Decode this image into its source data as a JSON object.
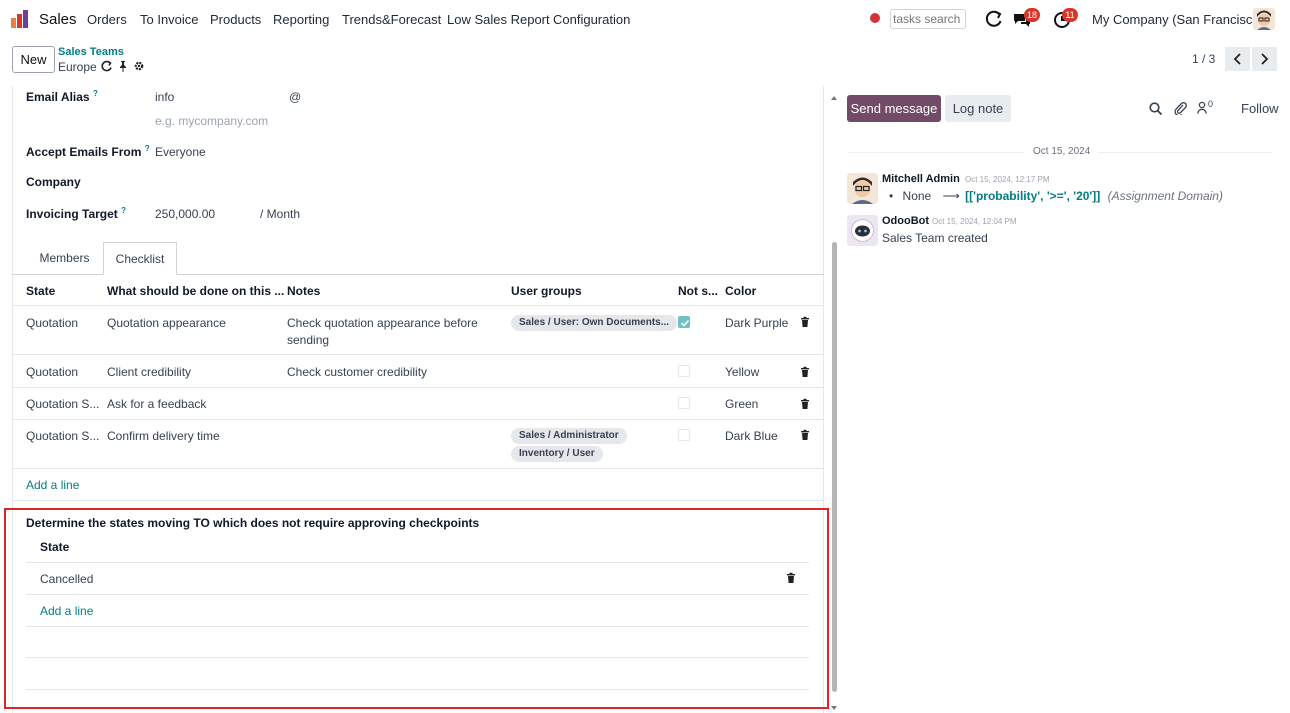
{
  "navbar": {
    "app_name": "Sales",
    "menus": [
      "Orders",
      "To Invoice",
      "Products",
      "Reporting",
      "Trends&Forecast",
      "Low Sales Report",
      "Configuration"
    ],
    "search_placeholder": "tasks search",
    "messages_badge": "18",
    "activities_badge": "11",
    "company": "My Company (San Francisco)",
    "record_color": "#d13438"
  },
  "control_panel": {
    "new_label": "New",
    "breadcrumb_parent": "Sales Teams",
    "breadcrumb_current": "Europe",
    "pager": "1 / 3"
  },
  "form": {
    "email_alias_label": "Email Alias",
    "email_alias_value": "info",
    "email_alias_at": "@",
    "email_domain_placeholder": "e.g. mycompany.com",
    "accept_from_label": "Accept Emails From",
    "accept_from_value": "Everyone",
    "company_label": "Company",
    "invoicing_target_label": "Invoicing Target",
    "invoicing_target_value": "250,000.00",
    "invoicing_target_unit": "/ Month",
    "tooltip_mark": "?"
  },
  "tabs": [
    "Members",
    "Checklist"
  ],
  "checklist": {
    "headers": [
      "State",
      "What should be done on this ...",
      "Notes",
      "User groups",
      "Not s...",
      "Color"
    ],
    "rows": [
      {
        "state": "Quotation",
        "task": "Quotation appearance",
        "notes_1": "Check quotation appearance before",
        "notes_2": "sending",
        "groups": [
          "Sales / User: Own Documents..."
        ],
        "checked": true,
        "color": "Dark Purple"
      },
      {
        "state": "Quotation",
        "task": "Client credibility",
        "notes_1": "Check customer credibility",
        "notes_2": "",
        "groups": [],
        "checked": false,
        "color": "Yellow"
      },
      {
        "state": "Quotation S...",
        "task": "Ask for a feedback",
        "notes_1": "",
        "notes_2": "",
        "groups": [],
        "checked": false,
        "color": "Green"
      },
      {
        "state": "Quotation S...",
        "task": "Confirm delivery time",
        "notes_1": "",
        "notes_2": "",
        "groups": [
          "Sales / Administrator",
          "Inventory / User"
        ],
        "checked": false,
        "color": "Dark Blue"
      }
    ],
    "add_line": "Add a line"
  },
  "states_section": {
    "title": "Determine the states moving TO which does not require approving checkpoints",
    "header": "State",
    "rows": [
      "Cancelled"
    ],
    "add_line": "Add a line"
  },
  "chatter": {
    "send_message": "Send message",
    "log_note": "Log note",
    "followers_count": "0",
    "follow": "Follow",
    "date_separator": "Oct 15, 2024",
    "messages": [
      {
        "author": "Mitchell Admin",
        "date": "Oct 15, 2024, 12:17 PM",
        "old_value": "None",
        "arrow": "⟶",
        "new_value": "[['probability', '>=', '20']]",
        "field": "(Assignment Domain)"
      },
      {
        "author": "OdooBot",
        "date": "Oct 15, 2024, 12:04 PM",
        "body": "Sales Team created"
      }
    ]
  },
  "colors": {
    "accent": "#714b67",
    "link": "#017e84",
    "highlight": "#e02424"
  }
}
